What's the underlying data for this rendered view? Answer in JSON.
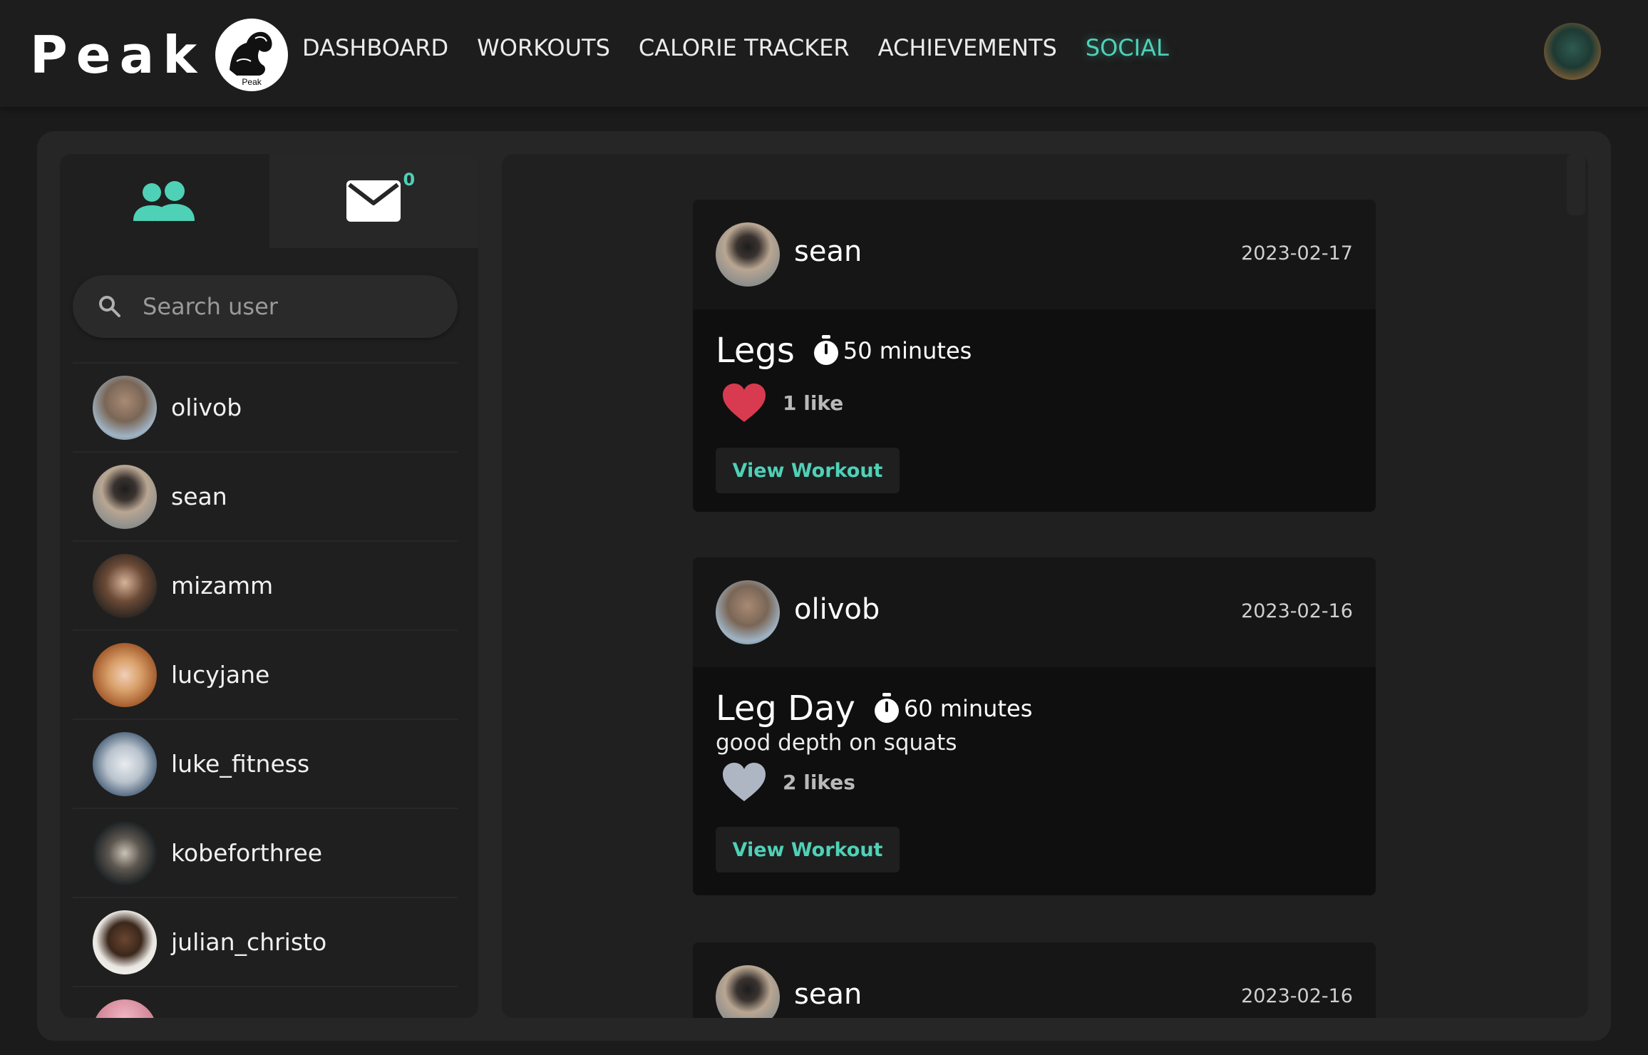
{
  "brand": {
    "name": "Peak",
    "logo_text": "Peak"
  },
  "nav": {
    "items": [
      {
        "label": "DASHBOARD",
        "active": false
      },
      {
        "label": "WORKOUTS",
        "active": false
      },
      {
        "label": "CALORIE TRACKER",
        "active": false
      },
      {
        "label": "ACHIEVEMENTS",
        "active": false
      },
      {
        "label": "SOCIAL",
        "active": true
      }
    ]
  },
  "sidebar": {
    "tabs": {
      "friends_icon": "users-icon",
      "messages_icon": "mail-icon",
      "message_count": "0"
    },
    "search": {
      "placeholder": "Search user",
      "value": ""
    },
    "users": [
      {
        "name": "olivob"
      },
      {
        "name": "sean"
      },
      {
        "name": "mizamm"
      },
      {
        "name": "lucyjane"
      },
      {
        "name": "luke_fitness"
      },
      {
        "name": "kobeforthree"
      },
      {
        "name": "julian_christo"
      }
    ]
  },
  "feed": {
    "posts": [
      {
        "user": "sean",
        "date": "2023-02-17",
        "workout": "Legs",
        "duration": "50 minutes",
        "caption": "",
        "likes": "1 like",
        "liked": true,
        "button": "View Workout"
      },
      {
        "user": "olivob",
        "date": "2023-02-16",
        "workout": "Leg Day",
        "duration": "60 minutes",
        "caption": "good depth on squats",
        "likes": "2 likes",
        "liked": false,
        "button": "View Workout"
      },
      {
        "user": "sean",
        "date": "2023-02-16"
      }
    ]
  },
  "colors": {
    "accent": "#4fd1b7",
    "like": "#d83a4f",
    "unliked": "#aeb6c4",
    "background": "#1b1b1b"
  }
}
